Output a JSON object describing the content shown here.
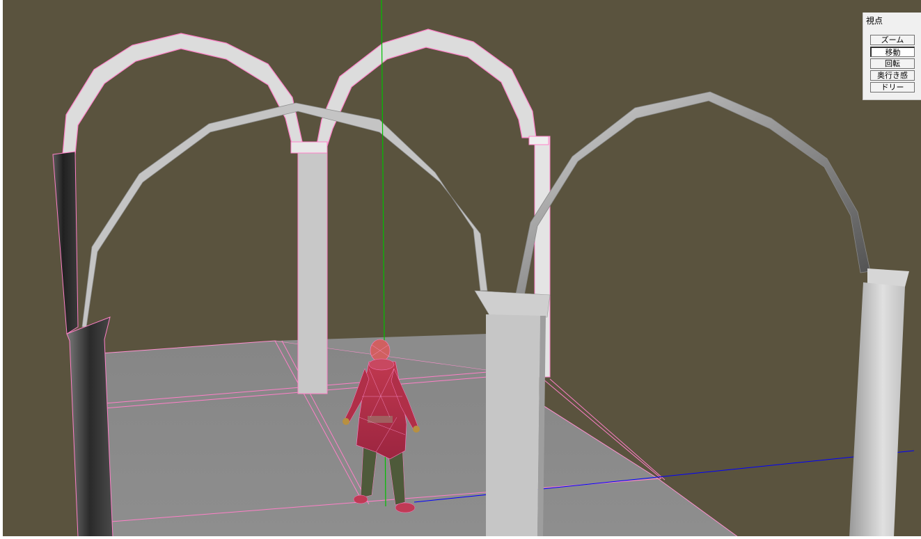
{
  "view_panel": {
    "title": "視点",
    "buttons": [
      {
        "id": "zoom",
        "label": "ズーム",
        "active": false
      },
      {
        "id": "move",
        "label": "移動",
        "active": true
      },
      {
        "id": "rotate",
        "label": "回転",
        "active": false
      },
      {
        "id": "depth",
        "label": "奥行き感",
        "active": false
      },
      {
        "id": "dolly",
        "label": "ドリー",
        "active": false
      }
    ]
  },
  "scene": {
    "background_color": "#5a533e",
    "floor_color": "#8a8a8a",
    "axis_colors": {
      "y_axis": "#00c000",
      "x_axis": "#0000ff"
    },
    "selection_wire_color": "#ff80d0",
    "character_color": "#b0304a"
  }
}
